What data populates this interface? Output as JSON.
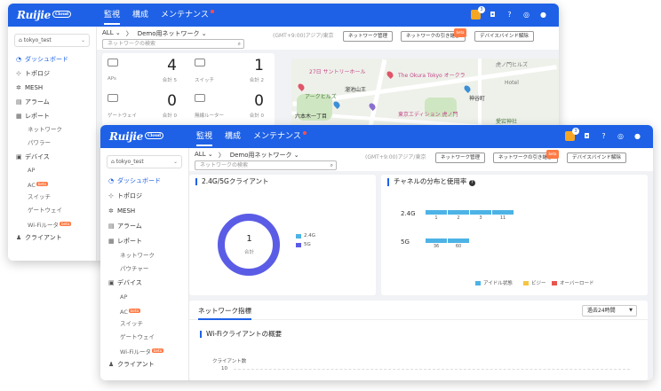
{
  "brand": {
    "logo": "Ruijie",
    "cloud": "Cloud"
  },
  "nav": {
    "monitor": "監視",
    "config": "構成",
    "maint": "メンテナンス"
  },
  "top_badge": "3",
  "tenant": "tokyo_test",
  "sidebar": {
    "dashboard": "ダッシュボード",
    "topology": "トポロジ",
    "mesh": "MESH",
    "alarm": "アラーム",
    "report": "レポート",
    "network": "ネットワーク",
    "power": "パワラー",
    "power_front": "パウチャー",
    "devices": "デバイス",
    "ap": "AP",
    "ac": "AC",
    "switch": "スイッチ",
    "gateway": "ゲートウェイ",
    "wifi_router": "Wi-Fiルータ",
    "clients": "クライアント",
    "beta": "beta"
  },
  "header": {
    "all": "ALL",
    "network_name": "Demo用ネットワーク",
    "search_placeholder": "ネットワークの検索",
    "timezone": "(GMT+9:00)アジア/東京",
    "btn_manage": "ネットワーク管理",
    "btn_handover": "ネットワークの引き継ぎ",
    "btn_unbind": "デバイスバインド解除"
  },
  "stats": [
    {
      "label": "APs",
      "value": "4",
      "total": "合計 5"
    },
    {
      "label": "スイッチ",
      "value": "1",
      "total": "合計 2"
    },
    {
      "label": "ゲートウェイ",
      "value": "0",
      "total": "合計 0"
    },
    {
      "label": "無線ルーター",
      "value": "0",
      "total": "合計 0"
    }
  ],
  "map_labels": [
    "27日 サントリーホール",
    "The Okura Tokyo オークラ",
    "Hotel",
    "虎ノ門ヒルズ",
    "六本木一丁目",
    "東京エディション 虎ノ門",
    "アークヒルズ",
    "溜池山王",
    "神谷町",
    "愛宕神社"
  ],
  "clients_card": {
    "title": "2.4G/5Gクライアント",
    "total": "1",
    "total_label": "合計",
    "legend_24": "2.4G",
    "legend_5": "5G"
  },
  "channel_card": {
    "title": "チャネルの分布と使用率",
    "row_24": "2.4G",
    "row_5": "5G",
    "ch24": [
      "1",
      "2",
      "3",
      "11"
    ],
    "ch5": [
      "36",
      "60"
    ],
    "legend_idle": "アイドル状態",
    "legend_busy": "ビジー",
    "legend_over": "オーバーロード"
  },
  "metrics_card": {
    "tab": "ネットワーク指標",
    "range": "過去24時間",
    "subtitle": "Wi-Fiクライアントの概要",
    "axis_label": "クライアント数",
    "tick_top": "10"
  },
  "colors": {
    "primary": "#1e61e6",
    "donut": "#5b5ce6",
    "bar": "#4db3e6",
    "busy": "#f5c542",
    "over": "#e8554e"
  }
}
